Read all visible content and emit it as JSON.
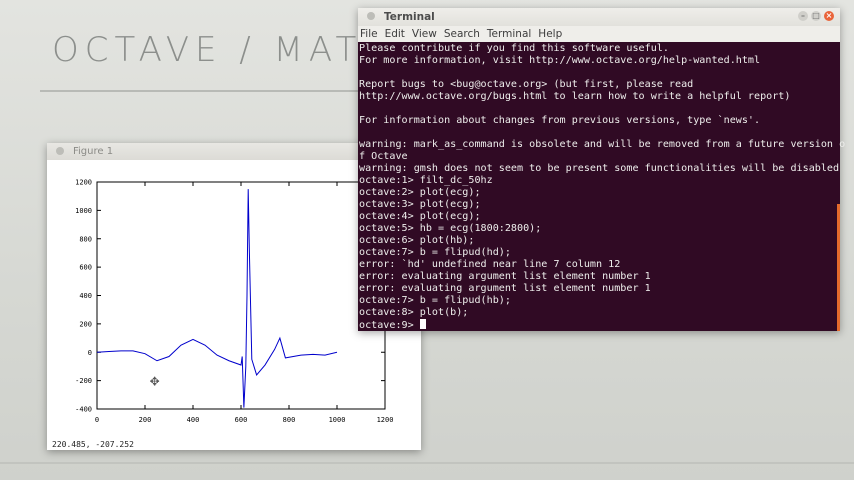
{
  "background": {
    "handwriting": "OCTAVE / MATL"
  },
  "terminal": {
    "title": "Terminal",
    "menu": [
      "File",
      "Edit",
      "View",
      "Search",
      "Terminal",
      "Help"
    ],
    "lines": [
      "Please contribute if you find this software useful.",
      "For more information, visit http://www.octave.org/help-wanted.html",
      "",
      "Report bugs to <bug@octave.org> (but first, please read",
      "http://www.octave.org/bugs.html to learn how to write a helpful report)",
      "",
      "For information about changes from previous versions, type `news'.",
      "",
      "warning: mark_as_command is obsolete and will be removed from a future version o",
      "f Octave",
      "warning: gmsh does not seem to be present some functionalities will be disabled",
      "octave:1> filt_dc_50hz",
      "octave:2> plot(ecg);",
      "octave:3> plot(ecg);",
      "octave:4> plot(ecg);",
      "octave:5> hb = ecg(1800:2800);",
      "octave:6> plot(hb);",
      "octave:7> b = flipud(hd);",
      "error: `hd' undefined near line 7 column 12",
      "error: evaluating argument list element number 1",
      "error: evaluating argument list element number 1",
      "octave:7> b = flipud(hb);",
      "octave:8> plot(b);"
    ],
    "prompt": "octave:9> "
  },
  "figure": {
    "title": "Figure 1",
    "status": "220.485, -207.252"
  },
  "chart_data": {
    "type": "line",
    "xlim": [
      0,
      1200
    ],
    "ylim": [
      -400,
      1200
    ],
    "xticks": [
      "0",
      "200",
      "400",
      "600",
      "800",
      "1000",
      "1200"
    ],
    "yticks": [
      "-400",
      "-200",
      "0",
      "200",
      "400",
      "600",
      "800",
      "1000",
      "1200"
    ],
    "grid": false,
    "color": "#0000cc",
    "series": [
      {
        "x": [
          0,
          50,
          100,
          150,
          200,
          250,
          300,
          350,
          400,
          450,
          500,
          550,
          600,
          605,
          612,
          620,
          625,
          630,
          635,
          645,
          665,
          700,
          740,
          762,
          785,
          850,
          900,
          950,
          1000
        ],
        "y": [
          0,
          5,
          10,
          10,
          -10,
          -60,
          -30,
          50,
          90,
          50,
          -20,
          -60,
          -90,
          -30,
          -390,
          -100,
          400,
          1150,
          700,
          -50,
          -160,
          -90,
          20,
          100,
          -40,
          -20,
          -15,
          -20,
          0
        ]
      }
    ]
  }
}
